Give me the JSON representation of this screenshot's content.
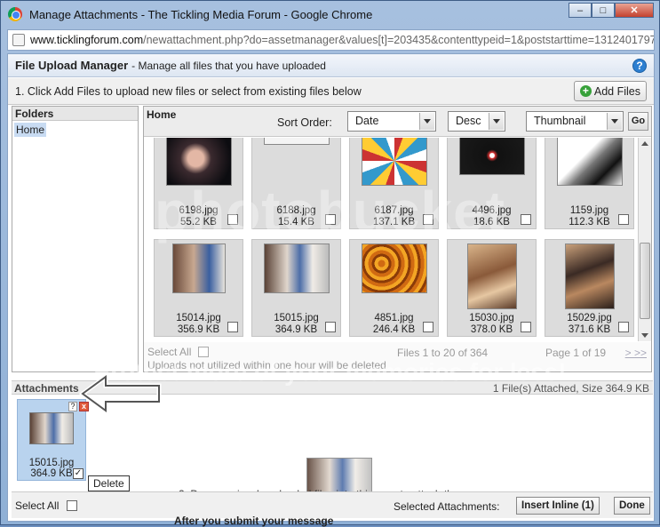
{
  "window": {
    "title": "Manage Attachments - The Tickling Media Forum - Google Chrome",
    "url_host": "www.ticklingforum.com",
    "url_path": "/newattachment.php?do=assetmanager&values[t]=203435&contenttypeid=1&poststarttime=1312401797&"
  },
  "header": {
    "title": "File Upload Manager",
    "subtitle": "- Manage all files that you have uploaded",
    "help_icon": "question-mark"
  },
  "instructions": {
    "text": "1. Click Add Files to upload new files or select from existing files below",
    "add_files_label": "Add Files"
  },
  "folders": {
    "heading": "Folders",
    "items": [
      {
        "label": "Home"
      }
    ]
  },
  "browser": {
    "crumb": "Home",
    "sort_label": "Sort Order:",
    "sort_field": "Date",
    "sort_dir": "Desc",
    "view_mode": "Thumbnail",
    "go_label": "Go",
    "files": [
      {
        "name": "6198.jpg",
        "size": "55.2 KB"
      },
      {
        "name": "6188.jpg",
        "size": "15.4 KB"
      },
      {
        "name": "6187.jpg",
        "size": "137.1 KB"
      },
      {
        "name": "4496.jpg",
        "size": "18.6 KB"
      },
      {
        "name": "1159.jpg",
        "size": "112.3 KB"
      },
      {
        "name": "15014.jpg",
        "size": "356.9 KB"
      },
      {
        "name": "15015.jpg",
        "size": "364.9 KB"
      },
      {
        "name": "4851.jpg",
        "size": "246.4 KB"
      },
      {
        "name": "15030.jpg",
        "size": "378.0 KB"
      },
      {
        "name": "15029.jpg",
        "size": "371.6 KB"
      }
    ],
    "footer": {
      "select_all": "Select All",
      "files_range": "Files 1 to 20 of 364",
      "page_info": "Page 1 of 19",
      "nav": ">  >>",
      "note": "Uploads not utilized within one hour will be deleted"
    }
  },
  "attachments": {
    "heading": "Attachments",
    "summary": "1 File(s) Attached, Size 364.9 KB",
    "item": {
      "name": "15015.jpg",
      "size": "364.9 KB",
      "help": "?",
      "delete": "x"
    },
    "tooltip": "Delete",
    "drag_hint": "2. Drag previously uploaded files into this area to attach them."
  },
  "bottom": {
    "select_all": "Select All",
    "selected_label": "Selected Attachments:",
    "insert_inline": "Insert Inline (1)",
    "done": "Done"
  },
  "watermark": {
    "main": "photobucket",
    "tagline": "Protect more of your memories for less!"
  },
  "below_text": "After you submit your message"
}
